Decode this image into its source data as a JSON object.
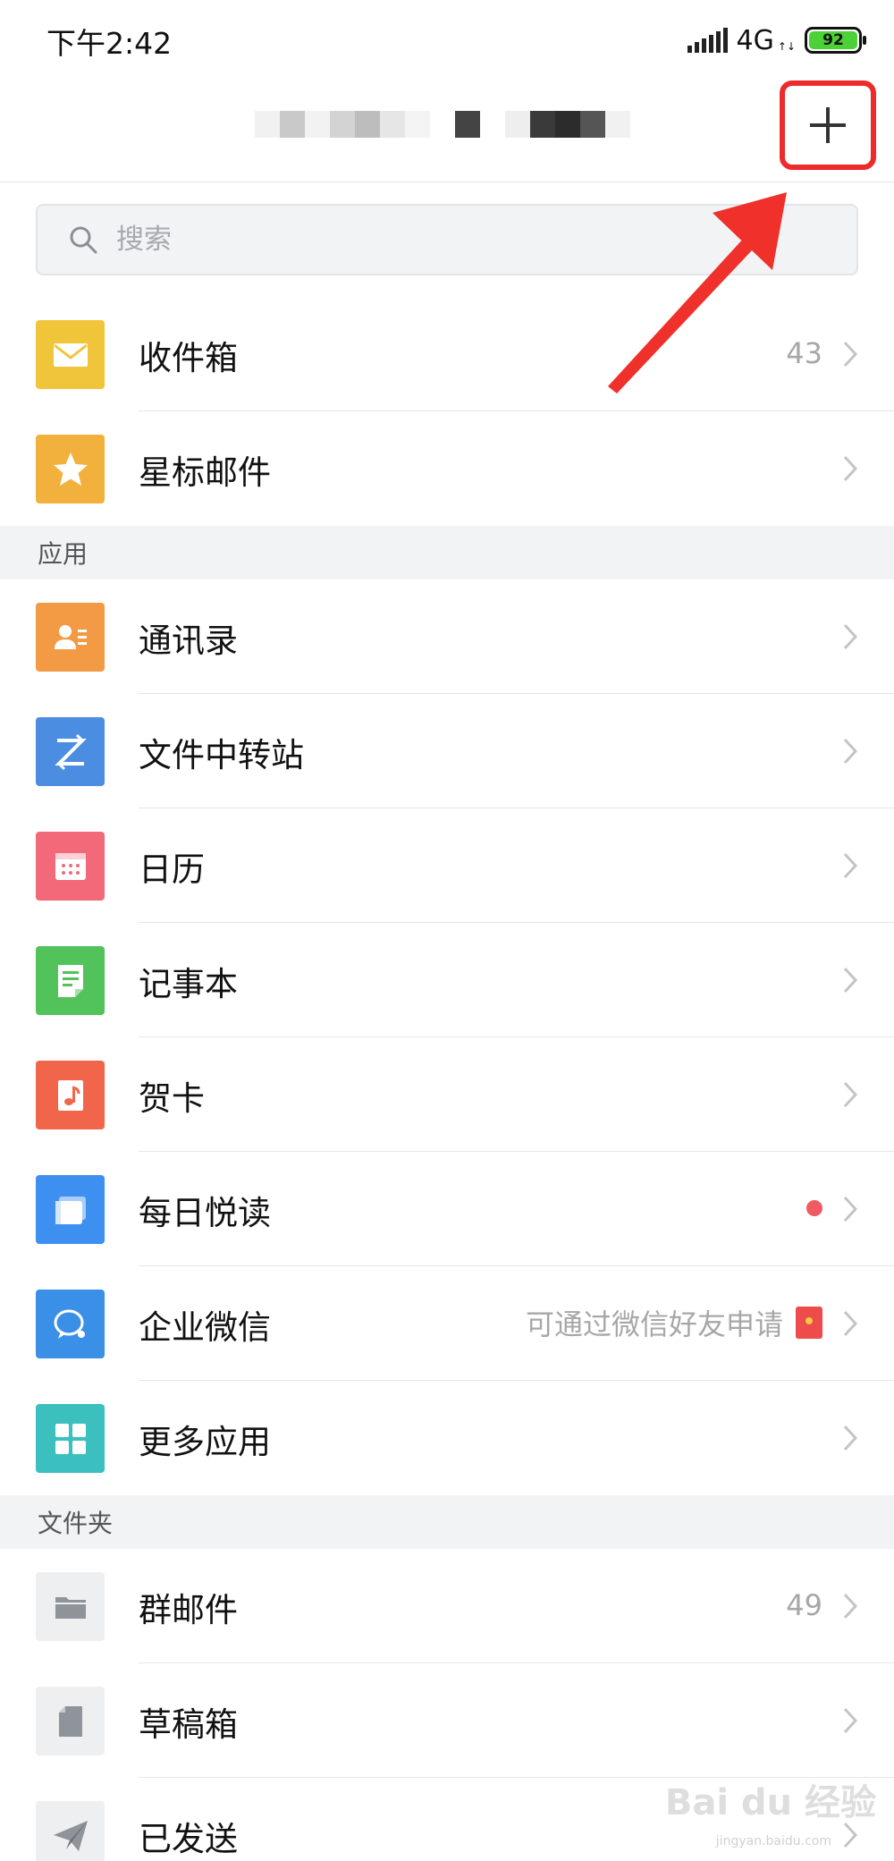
{
  "status": {
    "time": "下午2:42",
    "network": "4G",
    "battery": "92"
  },
  "search": {
    "placeholder": "搜索"
  },
  "mail": [
    {
      "label": "收件箱",
      "count": "43",
      "icon": "envelope-icon",
      "color": "#f0c53a"
    },
    {
      "label": "星标邮件",
      "count": "",
      "icon": "star-icon",
      "color": "#f2b13c"
    }
  ],
  "apps_header": "应用",
  "apps": [
    {
      "label": "通讯录",
      "icon": "contacts-icon",
      "color": "#f39a45"
    },
    {
      "label": "文件中转站",
      "icon": "transfer-icon",
      "color": "#4b8de0"
    },
    {
      "label": "日历",
      "icon": "calendar-icon",
      "color": "#f2697a"
    },
    {
      "label": "记事本",
      "icon": "notepad-icon",
      "color": "#52c25a"
    },
    {
      "label": "贺卡",
      "icon": "greeting-card-icon",
      "color": "#f1654b"
    },
    {
      "label": "每日悦读",
      "icon": "reading-icon",
      "color": "#3d8ff0"
    },
    {
      "label": "企业微信",
      "hint": "可通过微信好友申请",
      "icon": "wecom-icon",
      "color": "#3a8fe6"
    },
    {
      "label": "更多应用",
      "icon": "more-apps-icon",
      "color": "#3cbfbf"
    }
  ],
  "folders_header": "文件夹",
  "folders": [
    {
      "label": "群邮件",
      "count": "49",
      "icon": "folder-icon",
      "color": "#eeeff1"
    },
    {
      "label": "草稿箱",
      "count": "",
      "icon": "draft-icon",
      "color": "#eeeff1"
    },
    {
      "label": "已发送",
      "count": "",
      "icon": "sent-icon",
      "color": "#eeeff1"
    }
  ],
  "watermark": "Bai du 经验",
  "watermark_sub": "jingyan.baidu.com"
}
